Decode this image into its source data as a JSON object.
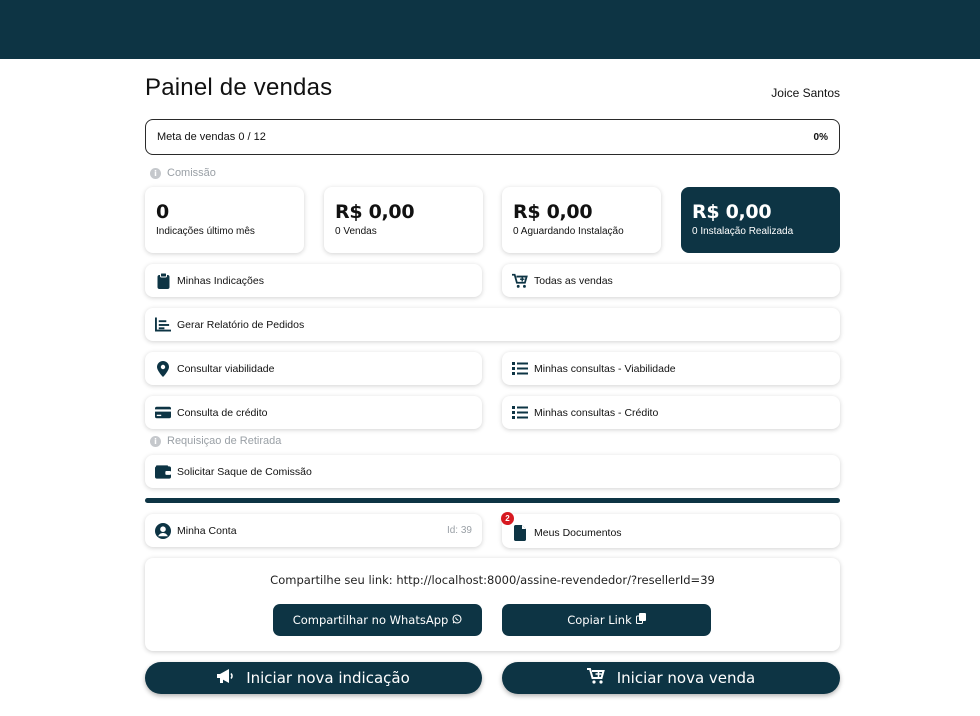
{
  "header": {
    "title": "Painel de vendas",
    "user_name": "Joice Santos"
  },
  "goal": {
    "label": "Meta de vendas 0 / 12",
    "percent_label": "0%",
    "progress": 0
  },
  "sections": {
    "commission": "Comissão",
    "withdrawal": "Requisiçao de Retirada"
  },
  "stats": [
    {
      "value": "0",
      "label": "Indicações último mês"
    },
    {
      "value": "R$ 0,00",
      "label": "0 Vendas"
    },
    {
      "value": "R$ 0,00",
      "label": "0 Aguardando Instalação"
    },
    {
      "value": "R$ 0,00",
      "label": "0 Instalação Realizada"
    }
  ],
  "menu": {
    "my_referrals": "Minhas Indicações",
    "all_sales": "Todas as vendas",
    "orders_report": "Gerar Relatório de Pedidos",
    "check_viability": "Consultar viabilidade",
    "my_viability_queries": "Minhas consultas - Viabilidade",
    "credit_check": "Consulta de crédito",
    "my_credit_queries": "Minhas consultas - Crédito",
    "request_withdrawal": "Solicitar Saque de Comissão",
    "my_account": "Minha Conta",
    "account_id": "Id: 39",
    "my_documents": "Meus Documentos",
    "documents_badge": "2"
  },
  "share": {
    "text": "Compartilhe seu link: http://localhost:8000/assine-revendedor/?resellerId=39",
    "whatsapp_label": "Compartilhar no WhatsApp",
    "copy_label": "Copiar Link"
  },
  "actions": {
    "new_referral": "Iniciar nova indicação",
    "new_sale": "Iniciar nova venda"
  },
  "colors": {
    "primary": "#0d3444",
    "badge": "#d71920"
  }
}
